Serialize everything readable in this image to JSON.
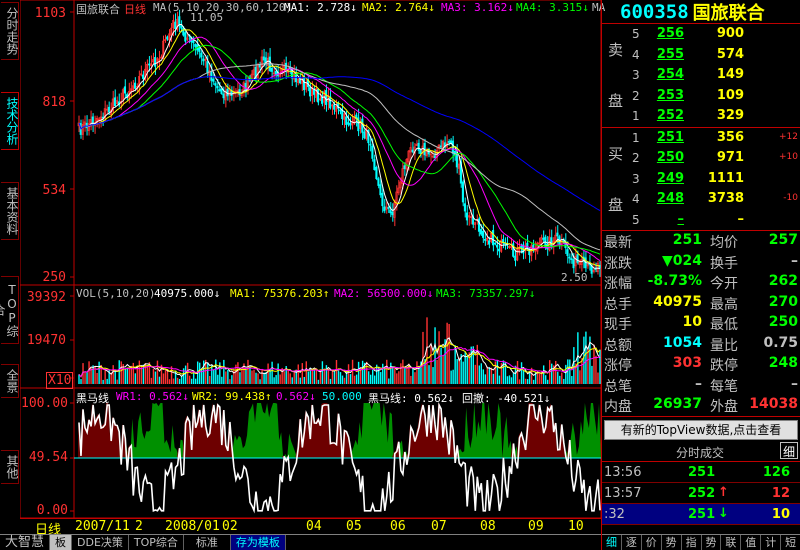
{
  "vtabs": [
    {
      "label": "分时走势",
      "active": false
    },
    {
      "label": "技术分析",
      "active": true
    },
    {
      "label": "基本资料",
      "active": false
    },
    {
      "label": "TOP综合",
      "active": false
    },
    {
      "label": "全景",
      "active": false
    },
    {
      "label": "其他",
      "active": false
    }
  ],
  "price_panel": {
    "header": {
      "name": "国旅联合",
      "period": "日线",
      "ma_title": "MA(5,10,20,30,60,120)",
      "ma1": "MA1: 2.728↓",
      "ma2": "MA2: 2.764↓",
      "ma3": "MA3: 3.162↓",
      "ma4": "MA4: 3.315↓",
      "ma5": "MA"
    },
    "y_labels": [
      "1103",
      "818",
      "534",
      "250"
    ],
    "high_label": "11.05",
    "low_label": "2.50"
  },
  "vol_panel": {
    "header": {
      "title": "VOL(5,10,20)",
      "val": "40975.000↓",
      "ma1": "MA1: 75376.203↑",
      "ma2": "MA2: 56500.000↓",
      "ma3": "MA3: 73357.297↓"
    },
    "y_labels": [
      "39392",
      "19470",
      "X10"
    ]
  },
  "ind_panel": {
    "header": {
      "title": "黑马线",
      "wr1": "WR1: 0.562↓",
      "wr2": "WR2: 99.438↑",
      "v3": "0.562↓",
      "v4": "50.000",
      "heima": "黑马线: 0.562↓",
      "huiche": "回撤: -40.521↓"
    },
    "y_labels": [
      "100.00",
      "49.54",
      "0.00"
    ]
  },
  "date_bar": {
    "prefix": "日线",
    "labels": [
      "2007/11",
      "2",
      "2008/01",
      "02",
      "04",
      "05",
      "06",
      "07",
      "08",
      "09",
      "10"
    ]
  },
  "bottom_tabs": [
    {
      "label": "大智慧",
      "style": "brand"
    },
    {
      "label": "板",
      "style": "on"
    },
    {
      "label": "DDE决策",
      "style": ""
    },
    {
      "label": "TOP综合",
      "style": ""
    },
    {
      "label": "标准",
      "style": ""
    },
    {
      "label": "存为模板",
      "style": "active"
    }
  ],
  "stock": {
    "code": "600358",
    "name": "国旅联合"
  },
  "order_book": {
    "sell_label": [
      "卖",
      "盘"
    ],
    "buy_label": [
      "买",
      "盘"
    ],
    "sell": [
      {
        "level": "5",
        "price": "256",
        "vol": "900",
        "chg": ""
      },
      {
        "level": "4",
        "price": "255",
        "vol": "574",
        "chg": ""
      },
      {
        "level": "3",
        "price": "254",
        "vol": "149",
        "chg": ""
      },
      {
        "level": "2",
        "price": "253",
        "vol": "109",
        "chg": ""
      },
      {
        "level": "1",
        "price": "252",
        "vol": "329",
        "chg": ""
      }
    ],
    "buy": [
      {
        "level": "1",
        "price": "251",
        "vol": "356",
        "chg": "+12"
      },
      {
        "level": "2",
        "price": "250",
        "vol": "971",
        "chg": "+10"
      },
      {
        "level": "3",
        "price": "249",
        "vol": "1111",
        "chg": ""
      },
      {
        "level": "4",
        "price": "248",
        "vol": "3738",
        "chg": "-10"
      },
      {
        "level": "5",
        "price": "–",
        "vol": "–",
        "chg": ""
      }
    ]
  },
  "quote": [
    {
      "l": "最新",
      "v": "251",
      "vc": "#00ff00",
      "l2": "均价",
      "v2": "257",
      "v2c": "#00ff00"
    },
    {
      "l": "涨跌",
      "v": "▼024",
      "vc": "#00ff00",
      "l2": "换手",
      "v2": "–",
      "v2c": "#c0c0c0"
    },
    {
      "l": "涨幅",
      "v": "-8.73%",
      "vc": "#00ff00",
      "l2": "今开",
      "v2": "262",
      "v2c": "#00ff00"
    },
    {
      "l": "总手",
      "v": "40975",
      "vc": "#ffff00",
      "l2": "最高",
      "v2": "270",
      "v2c": "#00ff00"
    },
    {
      "l": "现手",
      "v": "10",
      "vc": "#ffff00",
      "l2": "最低",
      "v2": "250",
      "v2c": "#00ff00"
    },
    {
      "l": "总额",
      "v": "1054",
      "vc": "#00ffff",
      "l2": "量比",
      "v2": "0.75",
      "v2c": "#c0c0c0"
    },
    {
      "l": "涨停",
      "v": "303",
      "vc": "#ff3232",
      "l2": "跌停",
      "v2": "248",
      "v2c": "#00ff00"
    },
    {
      "l": "总笔",
      "v": "–",
      "vc": "#c0c0c0",
      "l2": "每笔",
      "v2": "–",
      "v2c": "#c0c0c0"
    },
    {
      "l": "内盘",
      "v": "26937",
      "vc": "#00ff00",
      "l2": "外盘",
      "v2": "14038",
      "v2c": "#ff3232"
    }
  ],
  "topview_button": "有新的TopView数据,点击查看",
  "ticks": {
    "title": "分时成交",
    "toggle": "细",
    "rows": [
      {
        "time": "13:56",
        "price": "251",
        "arrow": "",
        "pc": "#00ff00",
        "vol": "126",
        "vc": "#00ff00"
      },
      {
        "time": "13:57",
        "price": "252",
        "arrow": "↑",
        "pc": "#00ff00",
        "vol": "12",
        "vc": "#ff3232"
      },
      {
        "time": ":32",
        "price": "251",
        "arrow": "↓",
        "pc": "#00ff00",
        "vol": "10",
        "vc": "#ffff00"
      }
    ]
  },
  "right_tabs": [
    "细",
    "逐",
    "价",
    "势",
    "指",
    "势",
    "联",
    "值",
    "计",
    "短"
  ],
  "colors": {
    "up": "#ff3232",
    "down": "#00ffff",
    "grid": "#c00000",
    "ma5": "#ffffff",
    "ma10": "#ffff00",
    "ma20": "#ff00ff",
    "ma30": "#00ff00",
    "ma60": "#c0c0c0",
    "ma120": "#0000ff"
  }
}
